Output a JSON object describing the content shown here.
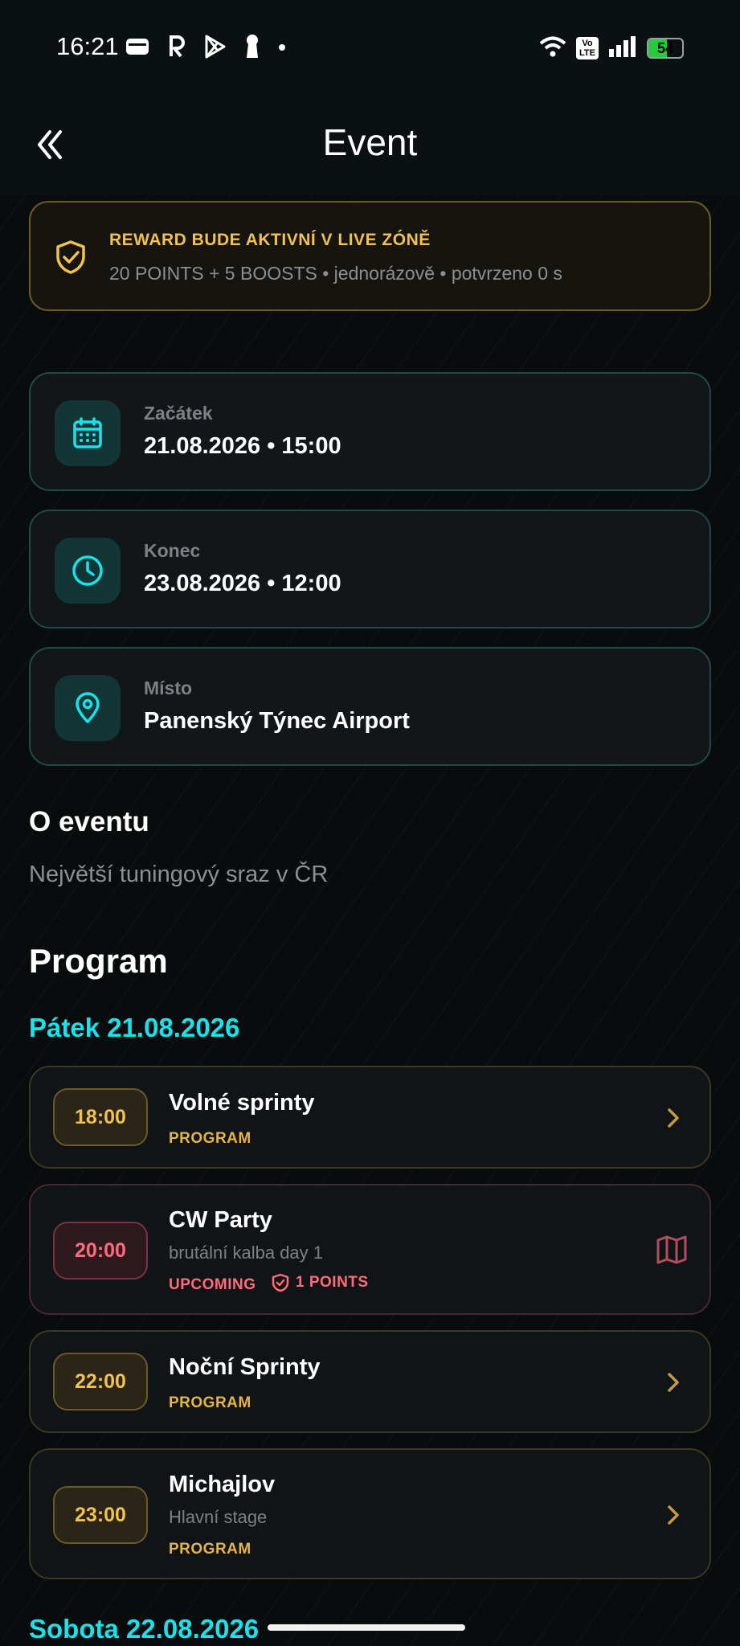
{
  "status_bar": {
    "time": "16:21",
    "left_icons": [
      "wallet-icon",
      "revolut-icon",
      "play-store-icon",
      "keyhole-icon",
      "dot-icon"
    ],
    "right_icons": [
      "wifi-icon",
      "volte-icon",
      "signal-icon",
      "battery-icon"
    ],
    "volte_label": "Vo\nLTE",
    "battery_level": "54",
    "battery_percent": 54
  },
  "appbar": {
    "title": "Event",
    "back_icon": "double-chevron-left-icon"
  },
  "reward": {
    "title": "REWARD BUDE AKTIVNÍ V LIVE ZÓNĚ",
    "subtitle": "20 POINTS + 5 BOOSTS • jednorázově • potvrzeno 0 s",
    "icon": "shield-check-icon"
  },
  "info": [
    {
      "label": "Začátek",
      "value": "21.08.2026 • 15:00",
      "icon": "calendar-icon"
    },
    {
      "label": "Konec",
      "value": "23.08.2026 • 12:00",
      "icon": "clock-icon"
    },
    {
      "label": "Místo",
      "value": "Panenský Týnec Airport",
      "icon": "location-pin-icon"
    }
  ],
  "about": {
    "heading": "O eventu",
    "text": "Největší tuningový sraz v ČR"
  },
  "program": {
    "heading": "Program",
    "days": [
      {
        "label": "Pátek 21.08.2026",
        "items": [
          {
            "time": "18:00",
            "title": "Volné sprinty",
            "tag": "PROGRAM"
          },
          {
            "time": "20:00",
            "title": "CW Party",
            "subtitle": "brutální kalba day 1",
            "tag": "UPCOMING",
            "points": "1 POINTS"
          },
          {
            "time": "22:00",
            "title": "Noční Sprinty",
            "tag": "PROGRAM"
          },
          {
            "time": "23:00",
            "title": "Michajlov",
            "subtitle": "Hlavní stage",
            "tag": "PROGRAM"
          }
        ]
      },
      {
        "label": "Sobota 22.08.2026"
      }
    ]
  },
  "colors": {
    "accent_cyan": "#19e3ea",
    "gold": "#f2c14e",
    "red": "#ff6b7a",
    "background": "#090c0d"
  }
}
